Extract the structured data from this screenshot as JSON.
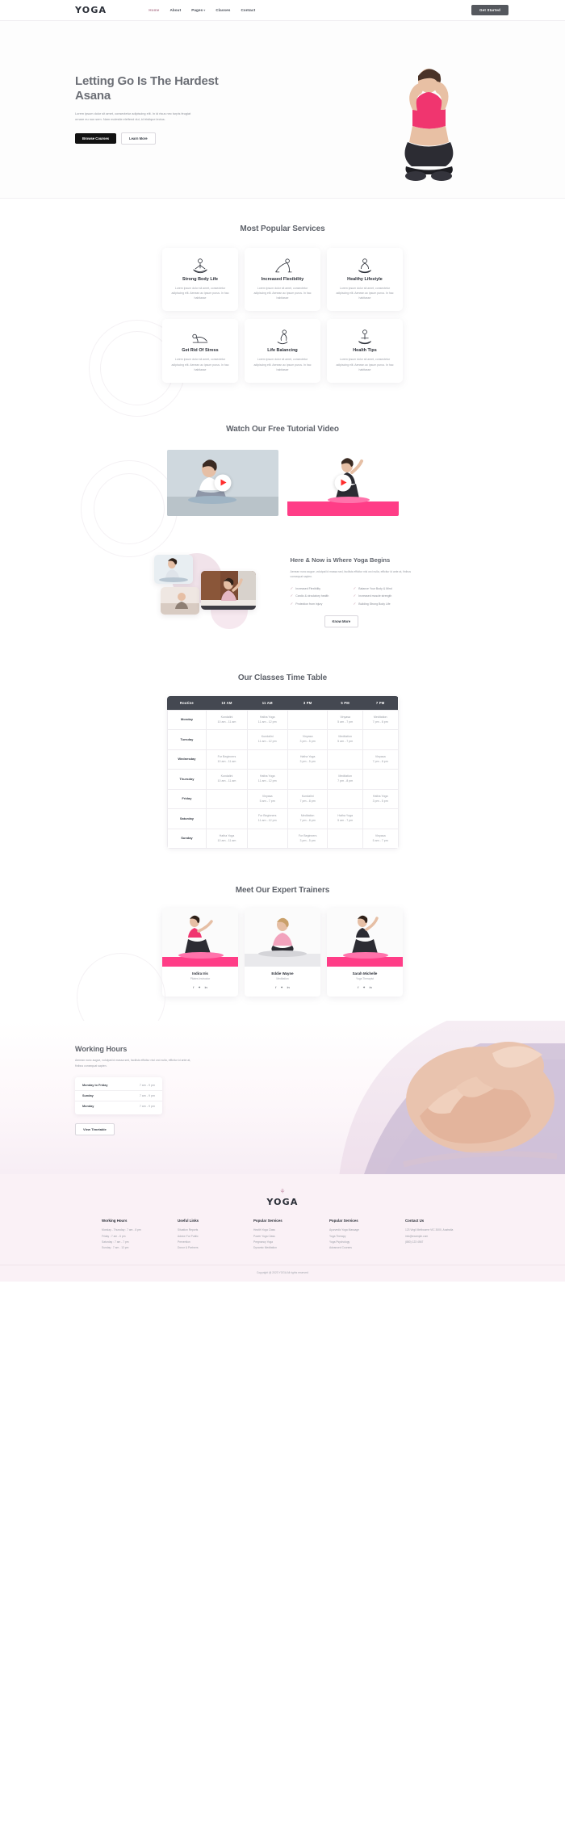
{
  "header": {
    "logo": "YOGA",
    "nav": [
      {
        "label": "Home",
        "active": true,
        "caret": false
      },
      {
        "label": "About",
        "active": false,
        "caret": false
      },
      {
        "label": "Pages",
        "active": false,
        "caret": true
      },
      {
        "label": "Classes",
        "active": false,
        "caret": false
      },
      {
        "label": "Contact",
        "active": false,
        "caret": false
      }
    ],
    "cta": "Get Started"
  },
  "hero": {
    "title": "Letting Go Is The Hardest Asana",
    "body": "Lorem ipsum dolor sit amet, consectetur adipiscing elit. In id risus nec turpis feugiat ornare eu non sem. Nam molestie eleifend dui, id tristique lectus.",
    "primary_btn": "Browse Courses",
    "secondary_btn": "Learn More"
  },
  "services": {
    "title": "Most Popular Services",
    "cards": [
      {
        "icon": "lotus-pose-icon",
        "title": "Strong Body Life",
        "text": "Lorem ipsum dolor sit amet, consectetur adipiscing elit. Aenean ac ipsum purus. In hac habitasse"
      },
      {
        "icon": "downward-dog-icon",
        "title": "Increased Flexibility",
        "text": "Lorem ipsum dolor sit amet, consectetur adipiscing elit. Aenean ac ipsum purus. In hac habitasse"
      },
      {
        "icon": "meditation-icon",
        "title": "Healthy Lifestyle",
        "text": "Lorem ipsum dolor sit amet, consectetur adipiscing elit. Aenean ac ipsum purus. In hac habitasse"
      },
      {
        "icon": "child-pose-icon",
        "title": "Get Rid Of Stress",
        "text": "Lorem ipsum dolor sit amet, consectetur adipiscing elit. Aenean ac ipsum purus. In hac habitasse"
      },
      {
        "icon": "balance-pose-icon",
        "title": "Life Balancing",
        "text": "Lorem ipsum dolor sit amet, consectetur adipiscing elit. Aenean ac ipsum purus. In hac habitasse"
      },
      {
        "icon": "seated-pose-icon",
        "title": "Health Tips",
        "text": "Lorem ipsum dolor sit amet, consectetur adipiscing elit. Aenean ac ipsum purus. In hac habitasse"
      }
    ]
  },
  "video": {
    "title": "Watch Our Free Tutorial Video",
    "items": [
      {
        "name": "tutorial-video-1",
        "play": "play-icon"
      },
      {
        "name": "tutorial-video-2",
        "play": "play-icon"
      }
    ]
  },
  "about": {
    "title": "Here & Now is Where Yoga Begins",
    "body": "Aenean nunc augue, volutpat id massa sed, facilisis efficitur nisl orci nulla, efficitur id ante at, finibus consequat sapien.",
    "checks": [
      "Increased Flexibility",
      "Balance Your Body & Mind",
      "Cardio & circulatory health",
      "Increased muscle strength",
      "Protection from injury",
      "Building Strong Body Life"
    ],
    "button": "Know More"
  },
  "timetable": {
    "title": "Our Classes Time Table",
    "columns": [
      "Routine",
      "10 AM",
      "11 AM",
      "3 PM",
      "5 PM",
      "7 PM"
    ],
    "rows": [
      {
        "day": "Monday",
        "cells": [
          {
            "name": "Kundalini",
            "time": "10 am - 11 am"
          },
          {
            "name": "Hatha Yoga",
            "time": "11 am - 12 pm"
          },
          null,
          {
            "name": "Vinyasa",
            "time": "5 am - 7 pm"
          },
          {
            "name": "Meditation",
            "time": "7 pm - 8 pm"
          }
        ]
      },
      {
        "day": "Tuesday",
        "cells": [
          null,
          {
            "name": "Kundalini",
            "time": "11 am - 12 pm"
          },
          {
            "name": "Vinyasa",
            "time": "3 pm - 5 pm"
          },
          {
            "name": "Meditation",
            "time": "5 am - 7 pm"
          },
          null
        ]
      },
      {
        "day": "Wednesday",
        "cells": [
          {
            "name": "For Beginners",
            "time": "10 am - 11 am"
          },
          null,
          {
            "name": "Hatha Yoga",
            "time": "3 pm - 5 pm"
          },
          null,
          {
            "name": "Vinyasa",
            "time": "7 pm - 8 pm"
          }
        ]
      },
      {
        "day": "Thursday",
        "cells": [
          {
            "name": "Kundalini",
            "time": "10 am - 11 am"
          },
          {
            "name": "Hatha Yoga",
            "time": "11 am - 12 pm"
          },
          null,
          {
            "name": "Meditation",
            "time": "7 pm - 8 pm"
          },
          null
        ]
      },
      {
        "day": "Friday",
        "cells": [
          null,
          {
            "name": "Vinyasa",
            "time": "5 am - 7 pm"
          },
          {
            "name": "Kundalini",
            "time": "7 pm - 8 pm"
          },
          null,
          {
            "name": "Hatha Yoga",
            "time": "3 pm - 5 pm"
          }
        ]
      },
      {
        "day": "Saturday",
        "cells": [
          null,
          {
            "name": "For Beginners",
            "time": "11 am - 12 pm"
          },
          {
            "name": "Meditation",
            "time": "7 pm - 8 pm"
          },
          {
            "name": "Hatha Yoga",
            "time": "5 am - 7 pm"
          },
          null
        ]
      },
      {
        "day": "Sunday",
        "cells": [
          {
            "name": "Hatha Yoga",
            "time": "10 am - 11 am"
          },
          null,
          {
            "name": "For Beginners",
            "time": "3 pm - 5 pm"
          },
          null,
          {
            "name": "Vinyasa",
            "time": "5 am - 7 pm"
          }
        ]
      }
    ]
  },
  "trainers": {
    "title": "Meet Our Expert Trainers",
    "list": [
      {
        "name": "Indira Iris",
        "role": "Pilates Instructor",
        "socials": [
          "facebook-icon",
          "twitter-icon",
          "linkedin-icon"
        ]
      },
      {
        "name": "Eddie Wayne",
        "role": "Meditation",
        "socials": [
          "facebook-icon",
          "twitter-icon",
          "linkedin-icon"
        ]
      },
      {
        "name": "Sarah Michelle",
        "role": "Yoga Therapist",
        "socials": [
          "facebook-icon",
          "twitter-icon",
          "linkedin-icon"
        ]
      }
    ]
  },
  "hours": {
    "title": "Working Hours",
    "body": "Aenean nunc augue, volutpat id massa sed, facilisis efficitur nisl orci nulla, efficitur id ante at, finibus consequat sapien.",
    "rows": [
      {
        "day": "Monday to Friday",
        "time": "7 am - 9 pm"
      },
      {
        "day": "Sunday",
        "time": "7 am - 9 pm"
      },
      {
        "day": "Monday",
        "time": "7 am - 9 pm"
      }
    ],
    "button": "View Timetable"
  },
  "footer": {
    "logo": "YOGA",
    "lotus_icon": "lotus-icon",
    "columns": [
      {
        "heading": "Working Hours",
        "items": [
          "Monday - Thursday : 7 am - 8 pm",
          "Friday : 7 am - 6 pm",
          "Saturday : 7 am - 7 pm",
          "Sunday : 7 am - 12 pm"
        ]
      },
      {
        "heading": "Useful Links",
        "items": [
          "Situation Reports",
          "Advice For Public",
          "Prevention",
          "Donor & Partners"
        ]
      },
      {
        "heading": "Popular Services",
        "items": [
          "Health Yoga Class",
          "Power Yoga Class",
          "Pregnancy Yoga",
          "Dynamic Meditation"
        ]
      },
      {
        "heading": "Popular Services",
        "items": [
          "Ayurvedic Yoga Massage",
          "Yoga Therapy",
          "Yoga Psychology",
          "Advanced Courses"
        ]
      },
      {
        "heading": "Contact Us",
        "items": [
          "123 Virgil Melbourne VIC 3000, Australia",
          "info@example.com",
          "(880) 123 4567"
        ]
      }
    ],
    "copyright": "Copyright @ 2023 YOGA All rights reserved"
  }
}
